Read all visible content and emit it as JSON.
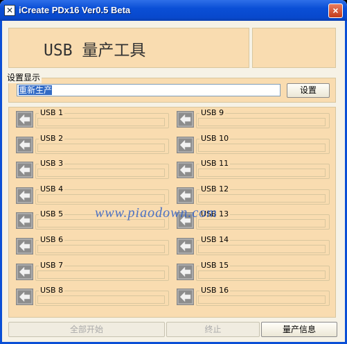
{
  "window": {
    "title": "iCreate PDx16 Ver0.5 Beta",
    "close_glyph": "×",
    "app_icon_glyph": "✕"
  },
  "header": {
    "title": "USB 量产工具"
  },
  "settings": {
    "legend": "设置显示",
    "value": "重新生产",
    "button_label": "设置"
  },
  "slots_left": [
    {
      "label": "USB 1"
    },
    {
      "label": "USB 2"
    },
    {
      "label": "USB 3"
    },
    {
      "label": "USB 4"
    },
    {
      "label": "USB 5"
    },
    {
      "label": "USB 6"
    },
    {
      "label": "USB 7"
    },
    {
      "label": "USB 8"
    }
  ],
  "slots_right": [
    {
      "label": "USB 9"
    },
    {
      "label": "USB 10"
    },
    {
      "label": "USB 11"
    },
    {
      "label": "USB 12"
    },
    {
      "label": "USB 13"
    },
    {
      "label": "USB 14"
    },
    {
      "label": "USB 15"
    },
    {
      "label": "USB 16"
    }
  ],
  "watermark": "www.piaodown.com",
  "footer": {
    "start_all": "全部开始",
    "stop": "终止",
    "info": "量产信息"
  },
  "colors": {
    "panel": "#f9dcb0",
    "title_blue": "#0a4fd6",
    "watermark": "#3060c8"
  }
}
